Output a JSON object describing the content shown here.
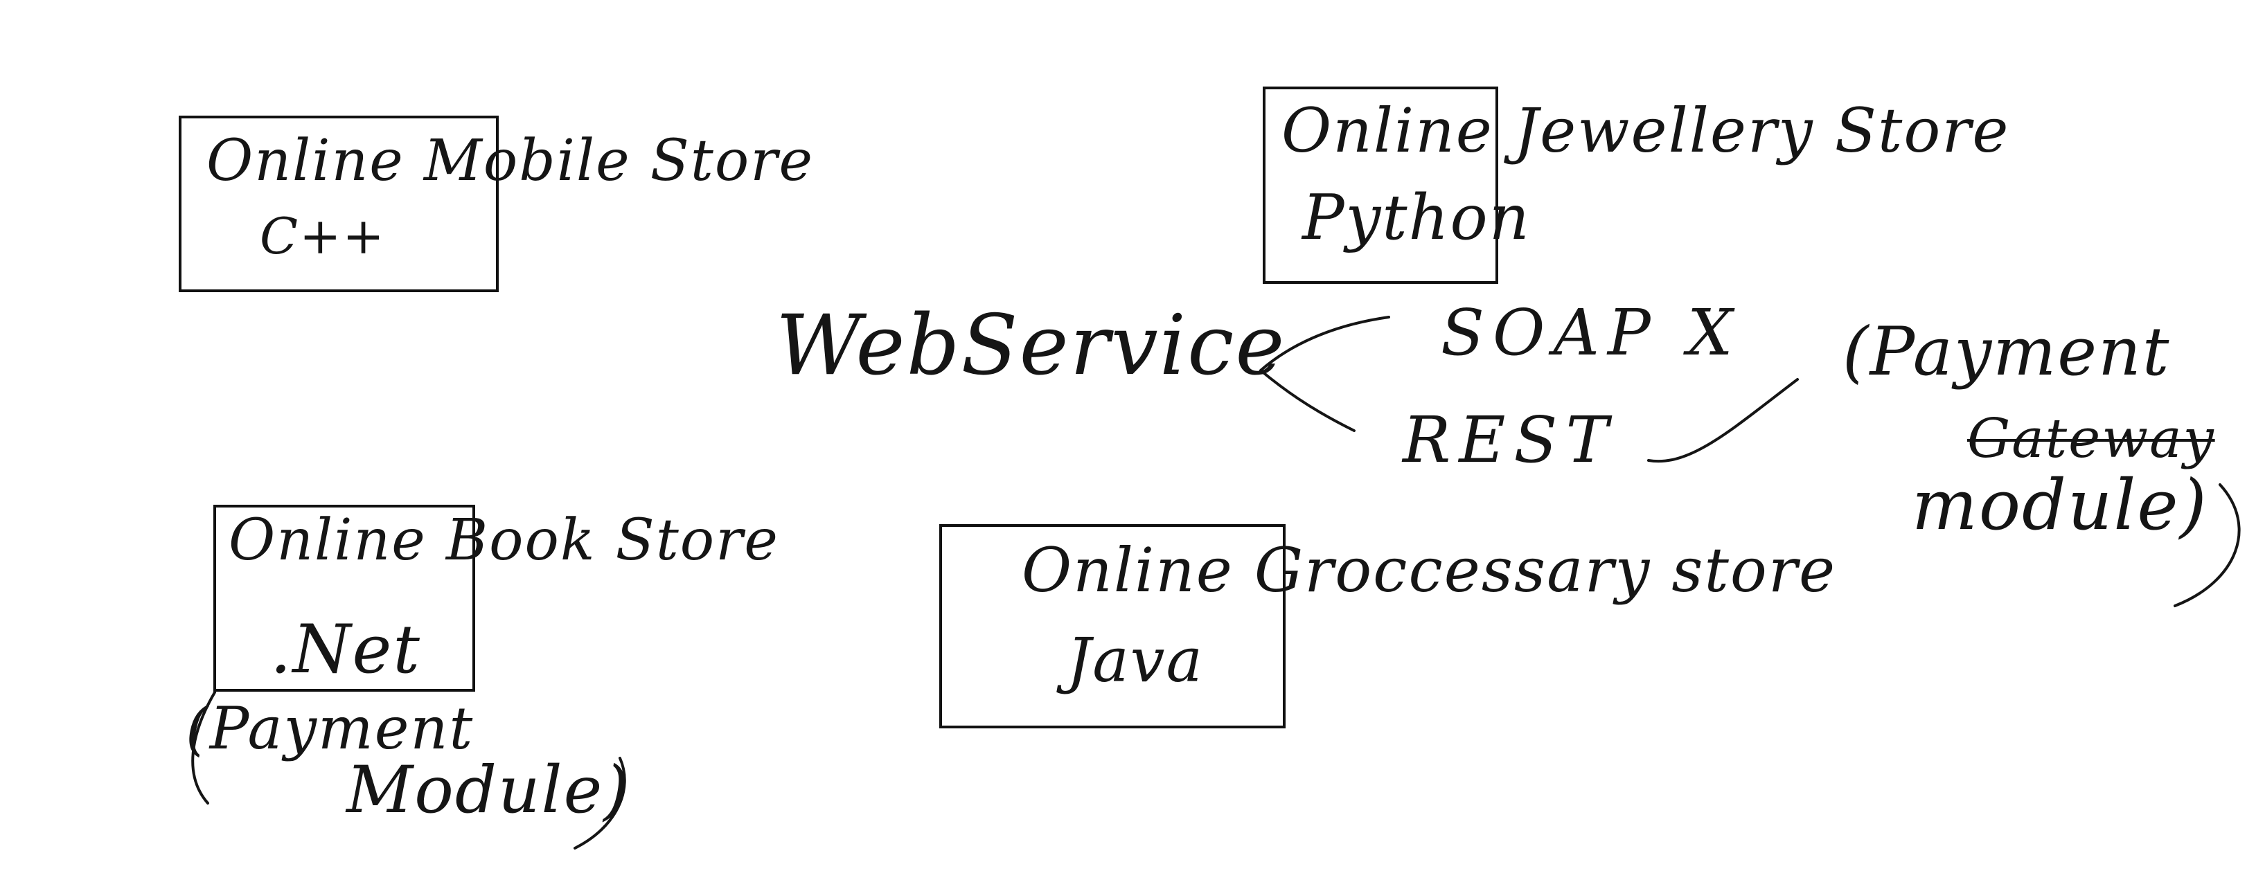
{
  "stores": [
    {
      "name": "Online Mobile Store",
      "tech": "C++"
    },
    {
      "name": "Online Jewellery Store",
      "tech": "Python"
    },
    {
      "name": "Online Book Store",
      "tech": ".Net",
      "note_line1": "(Payment",
      "note_line2": "Module)"
    },
    {
      "name": "Online Groccessary store",
      "tech": "Java"
    }
  ],
  "web_service": {
    "label": "WebService",
    "options": [
      "SOAP X",
      "REST"
    ]
  },
  "payment_gateway": {
    "line1": "(Payment",
    "struck": "Gateway",
    "line2": "module)"
  }
}
